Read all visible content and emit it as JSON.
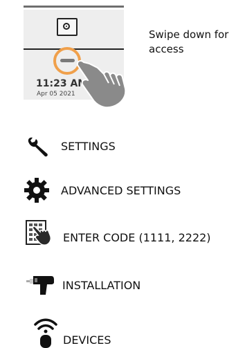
{
  "device": {
    "time": "11:23 AM",
    "date": "Apr 05 2021"
  },
  "hint": {
    "text": "Swipe down for access"
  },
  "menu": {
    "items": [
      {
        "label": "SETTINGS",
        "icon": "wrench-icon"
      },
      {
        "label": "ADVANCED SETTINGS",
        "icon": "gear-icon"
      },
      {
        "label": "ENTER CODE (1111, 2222)",
        "icon": "keypad-hand-icon"
      },
      {
        "label": "INSTALLATION",
        "icon": "drill-icon"
      },
      {
        "label": "DEVICES",
        "icon": "wireless-device-icon"
      }
    ]
  },
  "colors": {
    "accent": "#f0a04b",
    "icon": "#111111",
    "panel": "#eeeeee"
  }
}
